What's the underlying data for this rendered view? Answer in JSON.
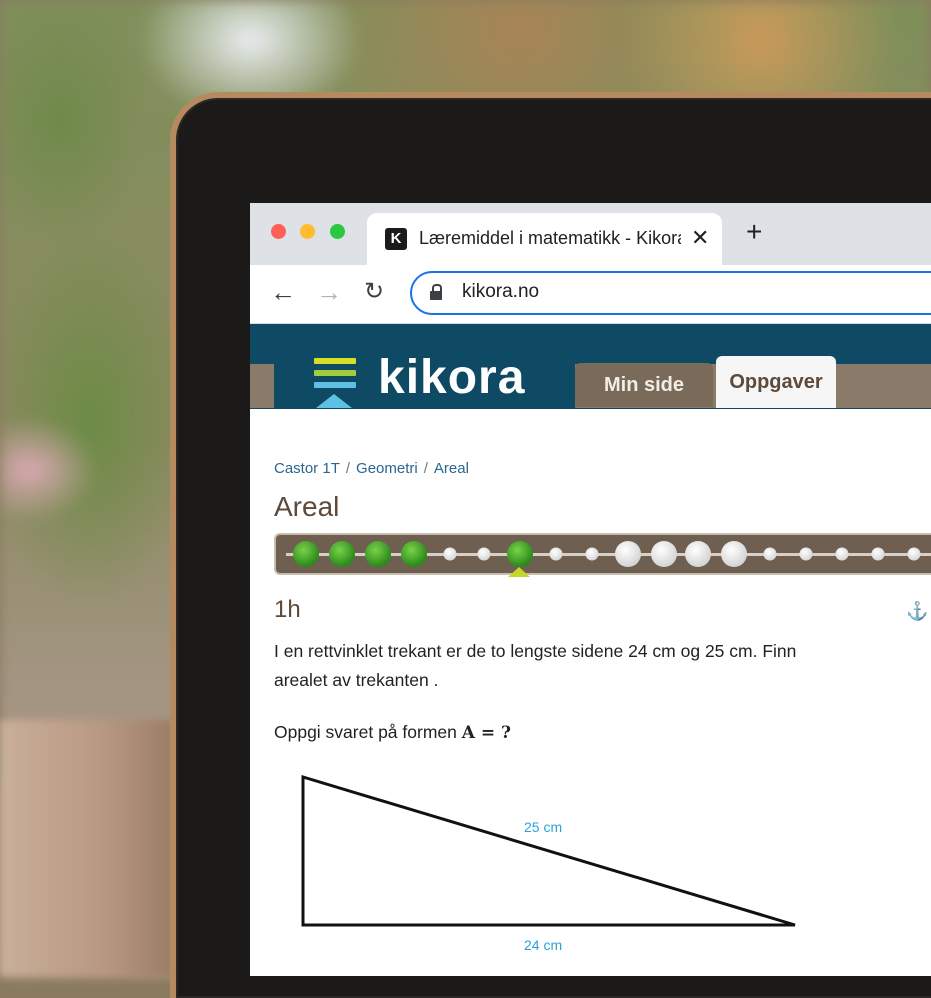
{
  "browser": {
    "tab_title": "Læremiddel i matematikk - Kikora",
    "favicon_letter": "K",
    "close_icon": "close-icon",
    "new_tab_icon": "plus-icon",
    "url": "kikora.no"
  },
  "site": {
    "logo_text": "kikora",
    "tabs": [
      {
        "label": "Min side",
        "active": false
      },
      {
        "label": "Oppgaver",
        "active": true
      }
    ],
    "breadcrumb": [
      "Castor 1T",
      "Geometri",
      "Areal"
    ],
    "page_title": "Areal",
    "progress": {
      "completed": 5,
      "current_index": 6
    },
    "task": {
      "id": "1h",
      "question_line1": "I en rettvinklet trekant er de to lengste sidene 24 cm og 25 cm. Finn",
      "question_line2": "arealet av trekanten .",
      "answer_hint_prefix": "Oppgi svaret på formen ",
      "answer_form": "A  =  ?",
      "figure": {
        "hypotenuse_label": "25 cm",
        "base_label": "24 cm"
      }
    }
  },
  "colors": {
    "site_header": "#0e4a63",
    "link": "#2a6690",
    "title": "#5d4a3a",
    "figure_label": "#2aa3d8"
  }
}
